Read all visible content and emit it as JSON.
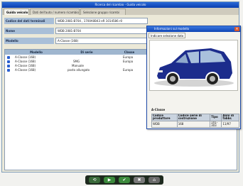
{
  "window": {
    "title": "Ricerca del ricambio - Guida veicolo"
  },
  "tabs": [
    {
      "label": "Guida veicolo",
      "active": true
    },
    {
      "label": "Dati dell'auto / numero ricambio",
      "active": false
    },
    {
      "label": "Selezione gruppo ricambi",
      "active": false
    }
  ],
  "form": {
    "fields": [
      {
        "label": "Codice del dati terminali",
        "value": "WDB 2081-B704 , 1700A0B43 eR 1014586 r0"
      },
      {
        "label": "Nome",
        "value": "WDB 2081-B704"
      },
      {
        "label": "Modello",
        "value": "A-Classe (168)"
      }
    ]
  },
  "list": {
    "columns": [
      "Modello",
      "Di serie",
      "Classe"
    ],
    "rows": [
      {
        "modello": "A-Classe (168)",
        "serie": "",
        "classe": "Europa"
      },
      {
        "modello": "A-Classe (168)",
        "serie": "SMG",
        "classe": "Europa"
      },
      {
        "modello": "A-Classe (168)",
        "serie": "Manuale",
        "classe": ""
      },
      {
        "modello": "A-Classe (168)",
        "serie": "posto allungato",
        "classe": "Europa"
      }
    ]
  },
  "popup": {
    "title": "Informazioni sul modello",
    "tab": "Indicare selezione dato",
    "car_name": "A-Classe",
    "table": {
      "headers": [
        "Codice produttore",
        "Codice serie di costruzione",
        "Tipo",
        "Anni di fabbr."
      ],
      "row": [
        "WDB",
        "168",
        "1X1-303",
        "11/97"
      ]
    },
    "car_color": "#1c2c8c"
  },
  "toolbar": {
    "buttons": [
      {
        "icon": "back-arrow-icon",
        "glyph": "⟲",
        "color": "#3a6a3a"
      },
      {
        "icon": "forward-icon",
        "glyph": "▶",
        "color": "#3c8a3c"
      },
      {
        "icon": "confirm-icon",
        "glyph": "✔",
        "color": "#3c8a3c"
      },
      {
        "icon": "cancel-icon",
        "glyph": "✖",
        "color": "#7a7a7a"
      },
      {
        "icon": "home-icon",
        "glyph": "⌂",
        "color": "#6a6a6a"
      }
    ]
  }
}
